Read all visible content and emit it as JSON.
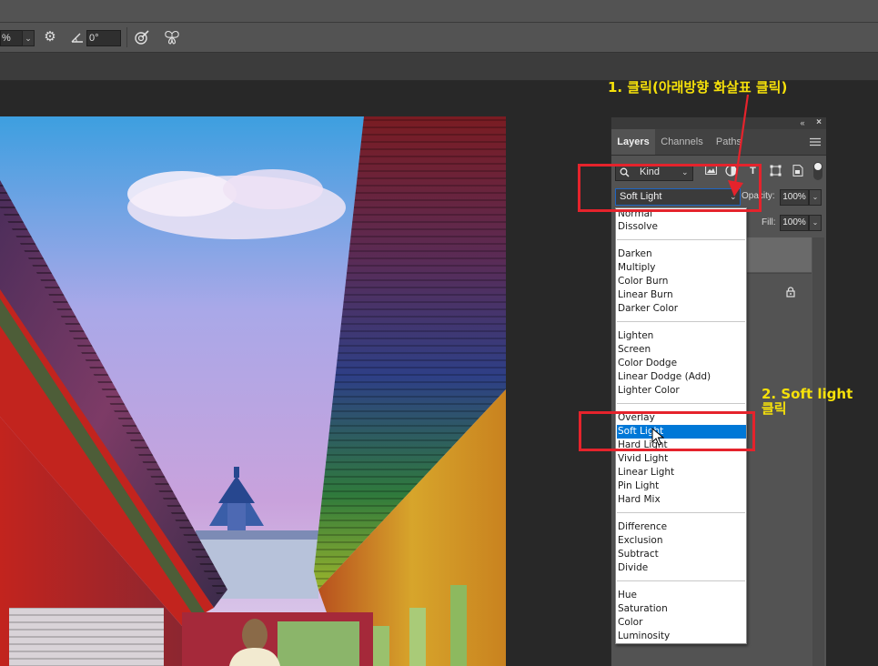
{
  "options_bar": {
    "zoom_fragment": "%",
    "angle_value": "0°",
    "icons": [
      "chevron-down-icon",
      "gear-icon",
      "angle-icon",
      "target-brush-icon",
      "butterfly-icon"
    ]
  },
  "layers_panel": {
    "collapse_icon": "double-chevron-left-icon",
    "close_icon": "close-icon",
    "tabs": [
      {
        "label": "Layers",
        "active": true
      },
      {
        "label": "Channels",
        "active": false
      },
      {
        "label": "Paths",
        "active": false
      }
    ],
    "menu_icon": "hamburger-menu-icon",
    "filter_kind": "Kind",
    "filter_icons": [
      "image-filter-icon",
      "adjustment-filter-icon",
      "type-filter-icon",
      "shape-filter-icon",
      "smart-object-filter-icon",
      "filter-toggle-icon"
    ],
    "blend_mode": "Soft Light",
    "opacity_label": "Opacity:",
    "opacity_value": "100%",
    "fill_label": "Fill:",
    "fill_value": "100%",
    "lock_icon": "lock-icon"
  },
  "blend_menu": {
    "groups": [
      [
        "Normal",
        "Dissolve"
      ],
      [
        "Darken",
        "Multiply",
        "Color Burn",
        "Linear Burn",
        "Darker Color"
      ],
      [
        "Lighten",
        "Screen",
        "Color Dodge",
        "Linear Dodge (Add)",
        "Lighter Color"
      ],
      [
        "Overlay",
        "Soft Light",
        "Hard Light",
        "Vivid Light",
        "Linear Light",
        "Pin Light",
        "Hard Mix"
      ],
      [
        "Difference",
        "Exclusion",
        "Subtract",
        "Divide"
      ],
      [
        "Hue",
        "Saturation",
        "Color",
        "Luminosity"
      ]
    ],
    "highlighted": "Soft Light"
  },
  "annotations": {
    "step1": "1. 클릭(아래방향 화살표 클릭)",
    "step2_line1": "2. Soft light",
    "step2_line2": "클릭"
  },
  "colors": {
    "annotation_red": "#e5232c",
    "annotation_yellow": "#f6e10a",
    "selection_blue": "#0078d7"
  }
}
